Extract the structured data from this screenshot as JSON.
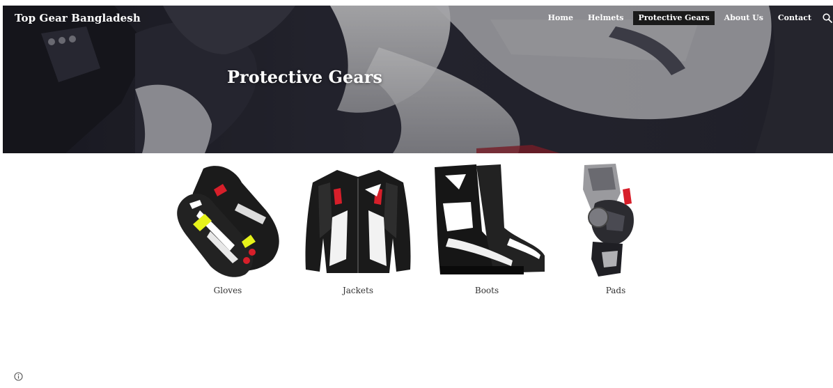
{
  "site": {
    "title": "Top Gear Bangladesh"
  },
  "nav": {
    "items": [
      {
        "label": "Home",
        "active": false
      },
      {
        "label": "Helmets",
        "active": false
      },
      {
        "label": "Protective Gears",
        "active": true
      },
      {
        "label": "About Us",
        "active": false
      },
      {
        "label": "Contact",
        "active": false
      }
    ],
    "search_icon": "search-icon"
  },
  "hero": {
    "heading": "Protective Gears"
  },
  "products": [
    {
      "label": "Gloves",
      "icon": "gloves-image"
    },
    {
      "label": "Jackets",
      "icon": "jacket-image"
    },
    {
      "label": "Boots",
      "icon": "boots-image"
    },
    {
      "label": "Pads",
      "icon": "knee-pad-image"
    }
  ],
  "footer": {
    "info_icon": "info-icon"
  },
  "colors": {
    "nav_active_bg": "#1a1a1a",
    "hero_text": "#ffffff",
    "product_label": "#333333"
  }
}
